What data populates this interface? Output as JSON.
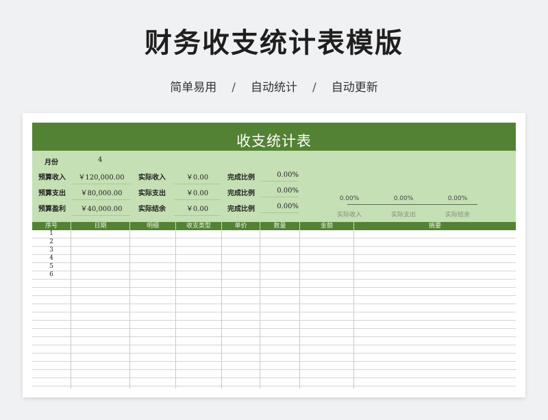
{
  "page": {
    "title": "财务收支统计表模版",
    "features": [
      "简单易用",
      "自动统计",
      "自动更新"
    ],
    "separator": "/"
  },
  "sheet": {
    "banner": "收支统计表",
    "month_label": "月份",
    "month_value": "4",
    "rows": [
      {
        "label": "预算收入",
        "value": "￥120,000.00",
        "actual_label": "实际收入",
        "actual_value": "￥0.00",
        "ratio_label": "完成比例",
        "ratio_value": "0.00%"
      },
      {
        "label": "预算支出",
        "value": "￥80,000.00",
        "actual_label": "实际支出",
        "actual_value": "￥0.00",
        "ratio_label": "完成比例",
        "ratio_value": "0.00%"
      },
      {
        "label": "预算盈利",
        "value": "￥40,000.00",
        "actual_label": "实际结余",
        "actual_value": "￥0.00",
        "ratio_label": "完成比例",
        "ratio_value": "0.00%"
      }
    ],
    "mini_chart": {
      "categories": [
        "实际收入",
        "实际支出",
        "实际结余"
      ],
      "values": [
        "0.00%",
        "0.00%",
        "0.00%"
      ]
    },
    "columns": [
      "序号",
      "日期",
      "明细",
      "收支类型",
      "单价",
      "数量",
      "金额",
      "摘要"
    ],
    "row_numbers": [
      "1",
      "2",
      "3",
      "4",
      "5",
      "6"
    ]
  },
  "colors": {
    "header_green": "#548235",
    "summary_green": "#c5e0b4"
  }
}
